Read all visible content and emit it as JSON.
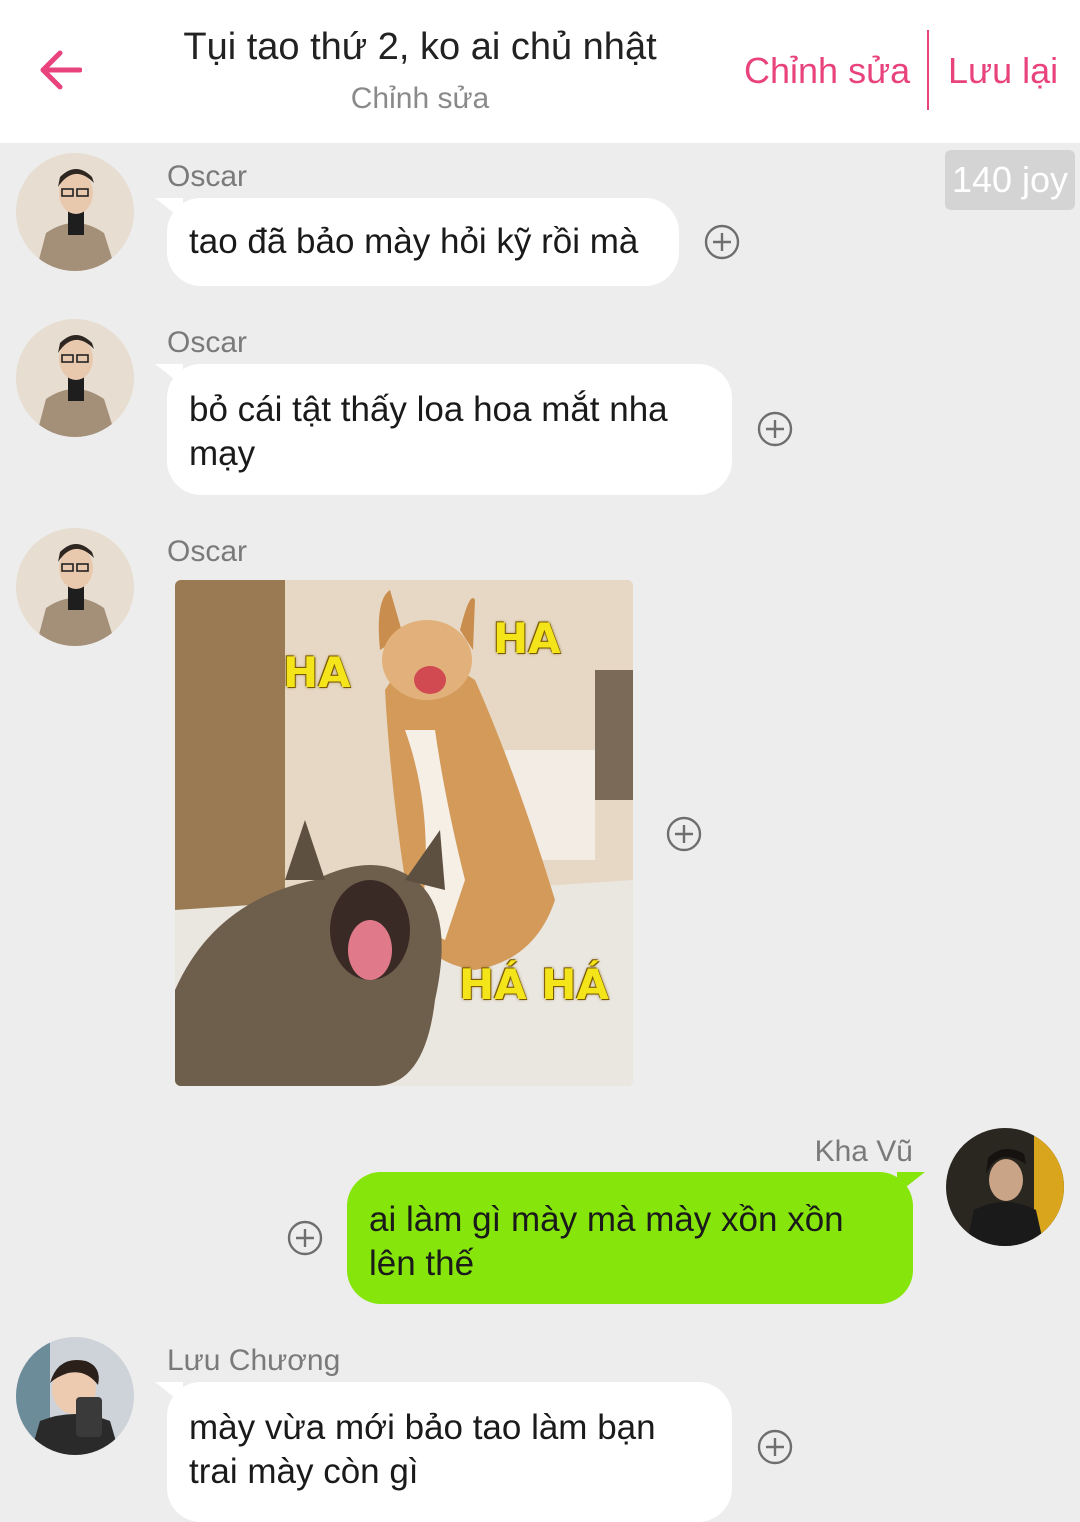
{
  "header": {
    "title": "Tụi tao thứ 2, ko ai chủ nhật",
    "subtitle": "Chỉnh sửa",
    "edit_label": "Chỉnh sửa",
    "save_label": "Lưu lại",
    "accent_color": "#e8437d"
  },
  "badge": {
    "joy_label": "140 joy"
  },
  "messages": [
    {
      "sender": "Oscar",
      "text": "tao đã bảo mày hỏi kỹ rồi mà"
    },
    {
      "sender": "Oscar",
      "text": "bỏ cái tật thấy loa hoa mắt nha mạy"
    },
    {
      "sender": "Oscar",
      "image": {
        "description_icon": "laughing-cats-meme",
        "captions": [
          "HA",
          "HA",
          "HÁ HÁ"
        ]
      }
    },
    {
      "sender": "Kha Vũ",
      "text": "ai làm gì mày mà mày xồn xồn lên thế",
      "mine": true
    },
    {
      "sender": "Lưu Chương",
      "text": "mày vừa mới bảo tao làm bạn trai mày còn gì"
    }
  ],
  "colors": {
    "my_bubble": "#86e50a",
    "other_bubble": "#ffffff",
    "background": "#ededed"
  },
  "icons": {
    "back": "arrow-left-icon",
    "reaction": "plus-circle-icon"
  }
}
